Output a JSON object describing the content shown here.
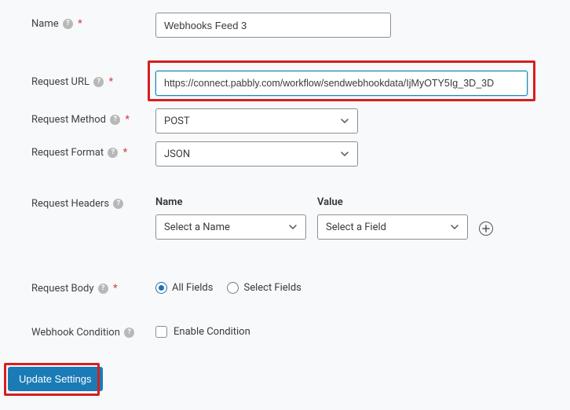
{
  "fields": {
    "name": {
      "label": "Name",
      "value": "Webhooks Feed 3"
    },
    "request_url": {
      "label": "Request URL",
      "value": "https://connect.pabbly.com/workflow/sendwebhookdata/IjMyOTY5Ig_3D_3D"
    },
    "request_method": {
      "label": "Request Method",
      "value": "POST"
    },
    "request_format": {
      "label": "Request Format",
      "value": "JSON"
    },
    "request_headers": {
      "label": "Request Headers",
      "name_header": "Name",
      "value_header": "Value",
      "name_placeholder": "Select a Name",
      "value_placeholder": "Select a Field"
    },
    "request_body": {
      "label": "Request Body",
      "option_all": "All Fields",
      "option_select": "Select Fields",
      "selected": "all"
    },
    "webhook_condition": {
      "label": "Webhook Condition",
      "checkbox_label": "Enable Condition",
      "checked": false
    }
  },
  "actions": {
    "submit": "Update Settings"
  },
  "glyphs": {
    "help": "?"
  }
}
